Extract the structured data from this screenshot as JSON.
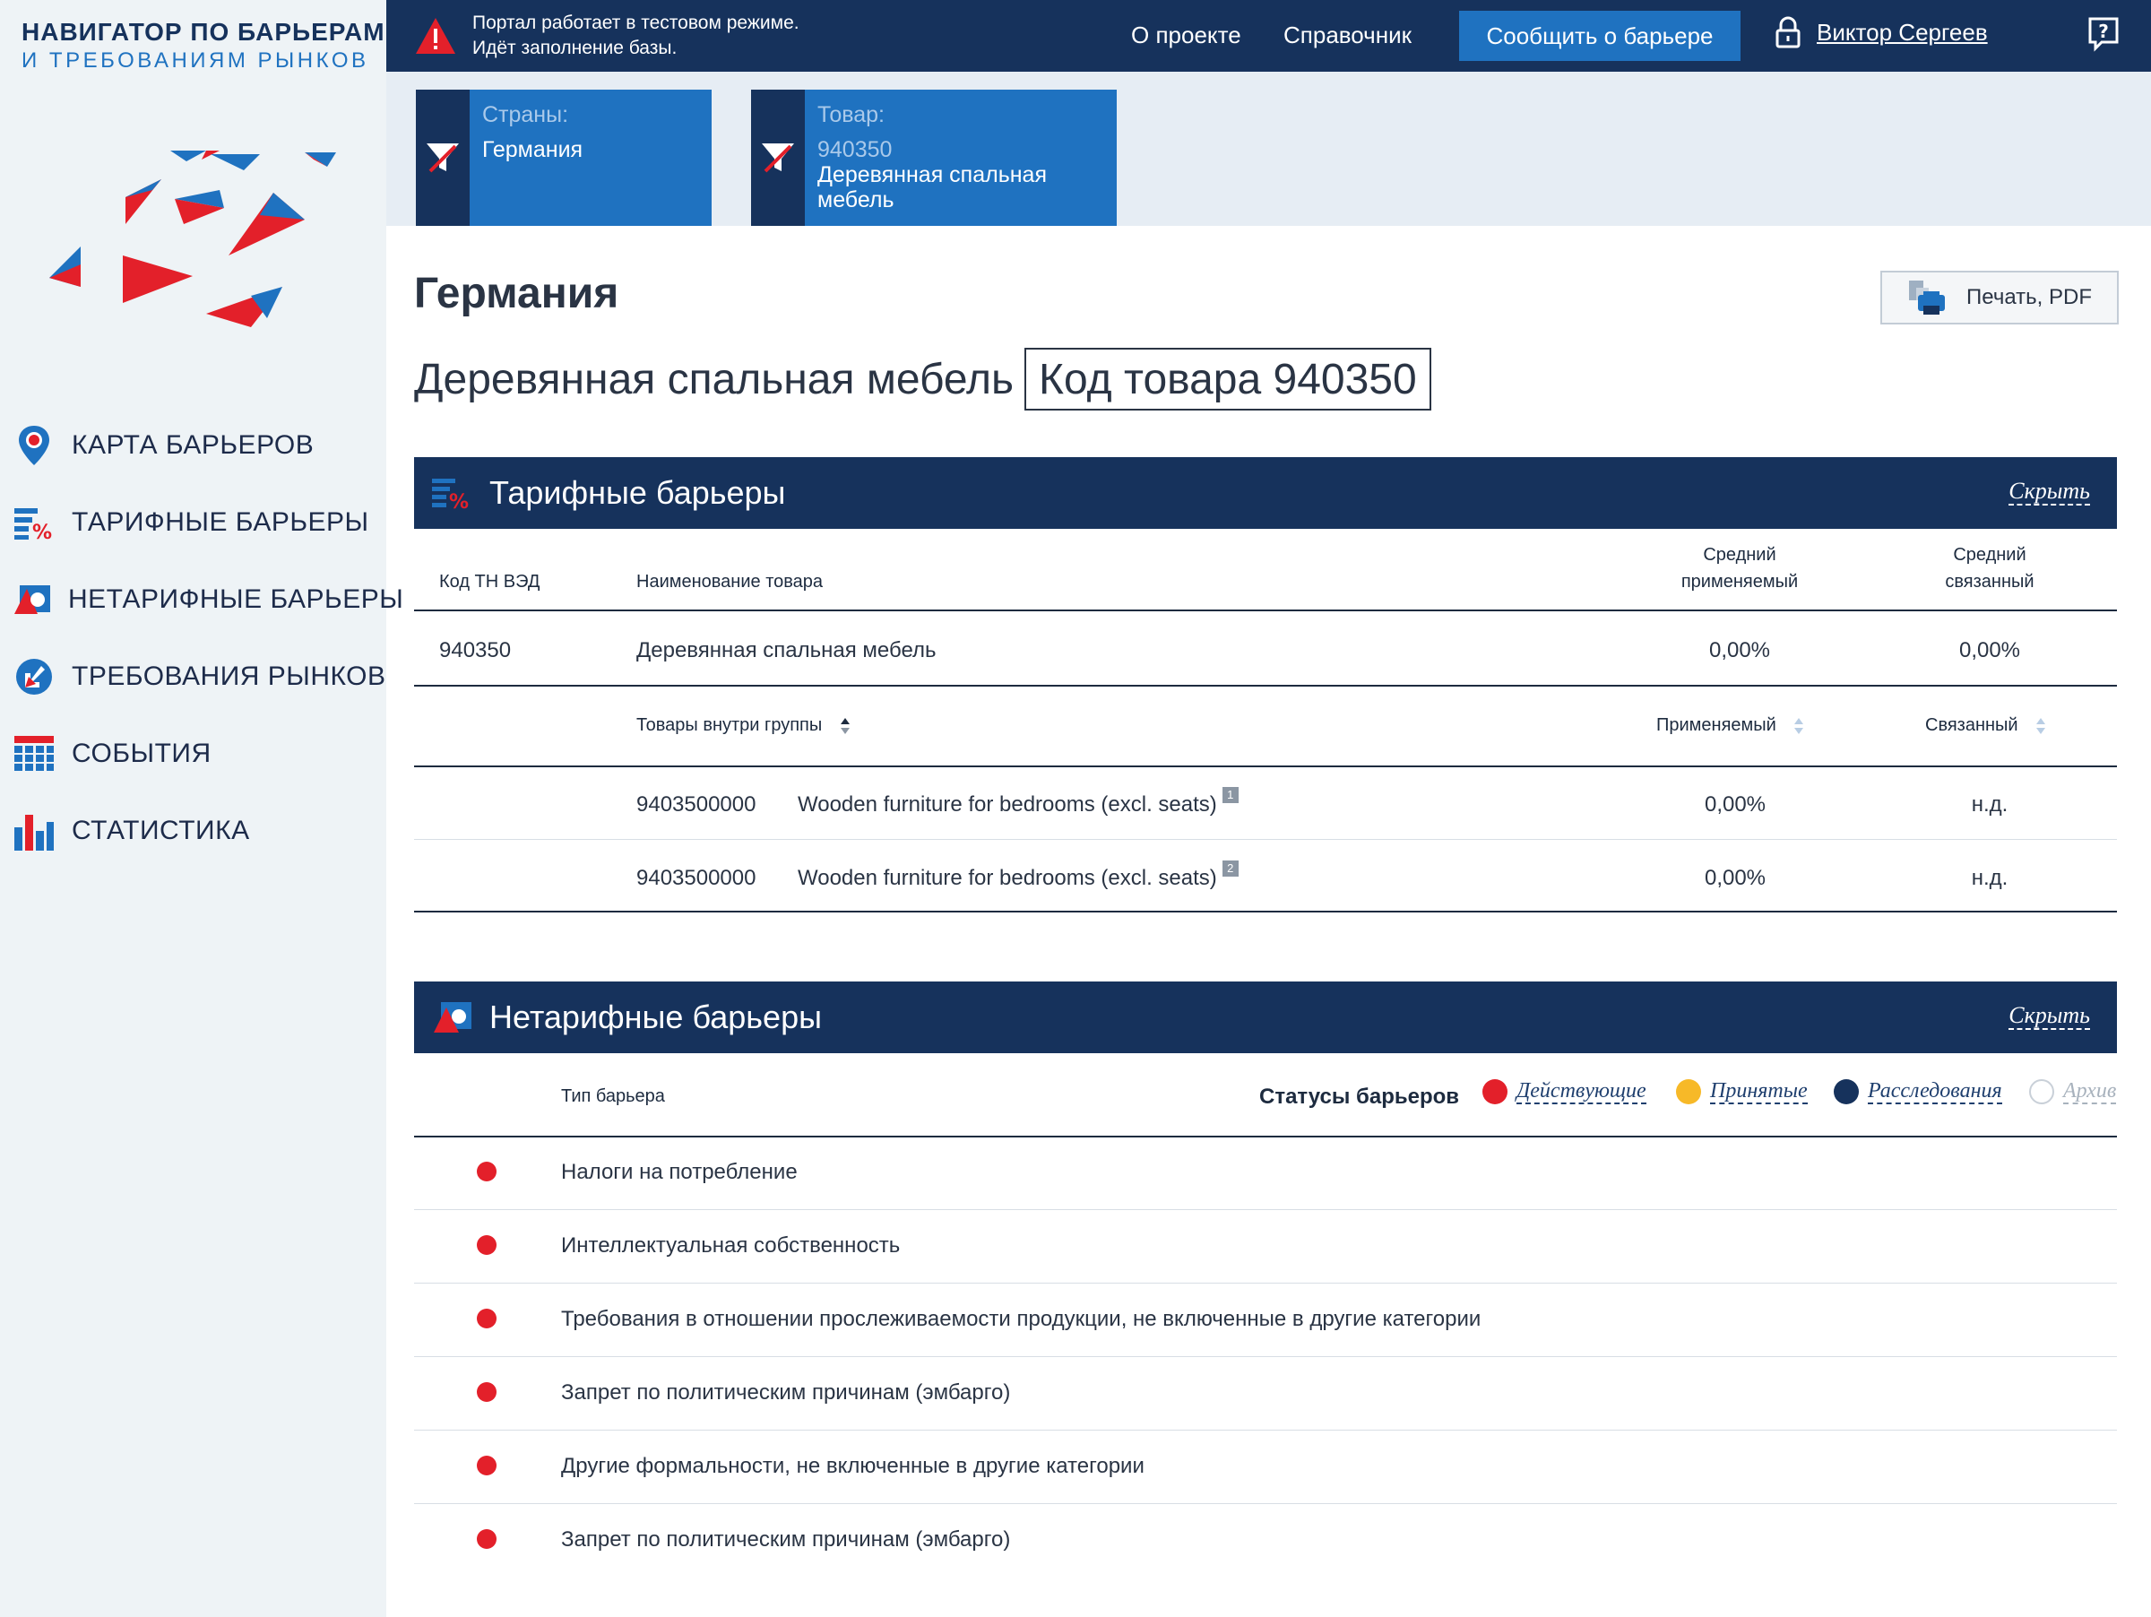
{
  "brand": {
    "line1": "НАВИГАТОР ПО БАРЬЕРАМ",
    "line2": "И ТРЕБОВАНИЯМ РЫНКОВ"
  },
  "sidebar": {
    "items": [
      {
        "label": "КАРТА БАРЬЕРОВ",
        "icon": "map-pin-icon"
      },
      {
        "label": "ТАРИФНЫЕ БАРЬЕРЫ",
        "icon": "tariff-icon"
      },
      {
        "label": "НЕТАРИФНЫЕ БАРЬЕРЫ",
        "icon": "nontariff-icon"
      },
      {
        "label": "ТРЕБОВАНИЯ РЫНКОВ",
        "icon": "requirements-icon"
      },
      {
        "label": "СОБЫТИЯ",
        "icon": "calendar-icon"
      },
      {
        "label": "СТАТИСТИКА",
        "icon": "chart-icon"
      }
    ]
  },
  "topbar": {
    "notice_line1": "Портал работает в тестовом режиме.",
    "notice_line2": "Идёт заполнение базы.",
    "about": "О проекте",
    "reference": "Справочник",
    "report_button": "Сообщить о барьере",
    "user_name": "Виктор Сергеев"
  },
  "filters": {
    "countries": {
      "caption": "Страны:",
      "value": "Германия"
    },
    "product": {
      "caption": "Товар:",
      "code": "940350",
      "name_line1": "Деревянная спальная",
      "name_line2": "мебель"
    }
  },
  "main": {
    "country": "Германия",
    "print_button": "Печать, PDF",
    "product_name": "Деревянная спальная мебель",
    "product_code": "Код товара 940350"
  },
  "tariff": {
    "title": "Тарифные барьеры",
    "hide": "Скрыть",
    "headers": {
      "code": "Код ТН ВЭД",
      "name": "Наименование товара",
      "avg_applied_1": "Средний",
      "avg_applied_2": "применяемый",
      "avg_bound_1": "Средний",
      "avg_bound_2": "связанный"
    },
    "row": {
      "code": "940350",
      "name": "Деревянная спальная мебель",
      "applied": "0,00%",
      "bound": "0,00%"
    },
    "sub_headers": {
      "group": "Товары внутри группы",
      "applied": "Применяемый",
      "bound": "Связанный"
    },
    "sub_rows": [
      {
        "code": "9403500000",
        "name": "Wooden furniture for bedrooms (excl. seats)",
        "note": "1",
        "applied": "0,00%",
        "bound": "н.д."
      },
      {
        "code": "9403500000",
        "name": "Wooden furniture for bedrooms (excl. seats)",
        "note": "2",
        "applied": "0,00%",
        "bound": "н.д."
      }
    ]
  },
  "nontariff": {
    "title": "Нетарифные барьеры",
    "hide": "Скрыть",
    "type_header": "Тип барьера",
    "statuses_label": "Статусы барьеров",
    "statuses": [
      {
        "label": "Действующие",
        "color": "#e3202a"
      },
      {
        "label": "Принятые",
        "color": "#f7b928"
      },
      {
        "label": "Расследования",
        "color": "#16325c"
      },
      {
        "label": "Архив",
        "color": "#ffffff"
      }
    ],
    "rows": [
      "Налоги на потребление",
      "Интеллектуальная собственность",
      "Требования в отношении прослеживаемости продукции, не включенные в другие категории",
      "Запрет по политическим причинам (эмбарго)",
      "Другие формальности, не включенные в другие категории",
      "Запрет по политическим причинам (эмбарго)"
    ]
  },
  "colors": {
    "navy": "#16325c",
    "blue": "#1f72c0",
    "red": "#e3202a",
    "sidebar_bg": "#eef3f6"
  }
}
